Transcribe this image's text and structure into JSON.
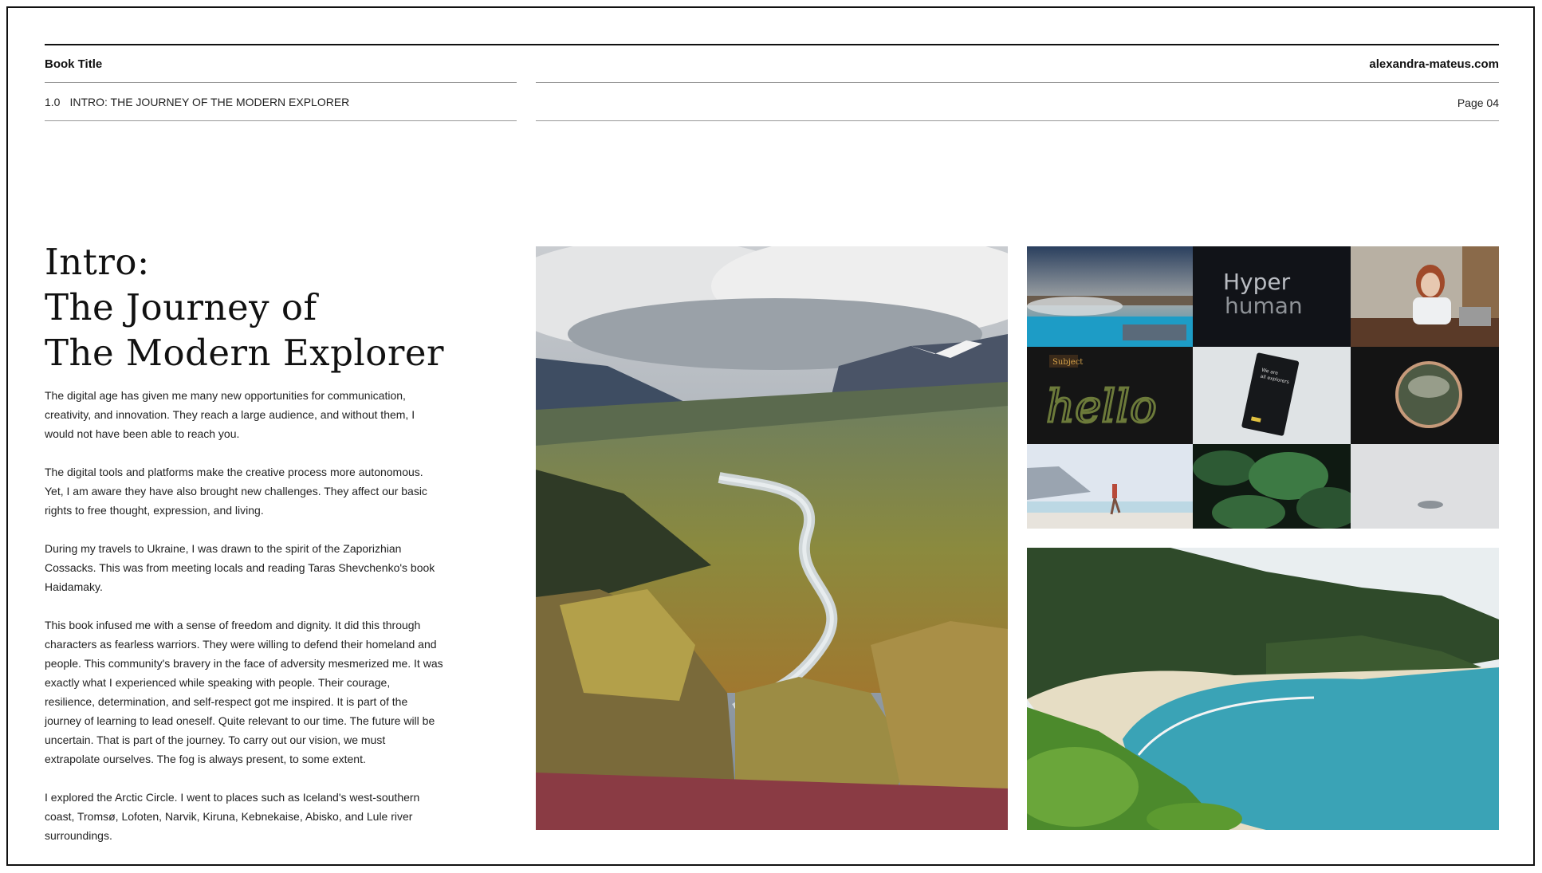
{
  "header": {
    "book_title": "Book Title",
    "site": "alexandra-mateus.com",
    "section_number": "1.0",
    "section_title": "INTRO: THE JOURNEY OF THE MODERN EXPLORER",
    "page": "Page 04"
  },
  "heading": {
    "line1": "Intro:",
    "line2": "The Journey of",
    "line3": "The Modern Explorer"
  },
  "paragraphs": [
    "The digital age has given me many new opportunities for communication, creativity, and innovation. They reach a large audience, and without them, I would not have been able to reach you.",
    "The digital tools and platforms make the creative process more autonomous. Yet, I am aware they have also brought new challenges. They affect our basic rights to free thought, expression, and living.",
    "During my travels to Ukraine, I was drawn to the spirit of the Zaporizhian Cossacks. This was from meeting locals and reading Taras Shevchenko's book Haidamaky.",
    "This book infused me with a sense of freedom and dignity. It did this through characters as fearless warriors. They were willing to defend their homeland and people. This community's bravery in the face of adversity mesmerized me. It was exactly what I experienced while speaking with people. Their courage, resilience, determination, and self-respect got me inspired. It is part of the journey of learning to lead oneself. Quite relevant to our time. The future will be uncertain. That is part of the journey. To carry out our vision, we must extrapolate ourselves. The fog is always present, to some extent.",
    "I explored the Arctic Circle. I went to places such as Iceland's west-southern coast, Tromsø, Lofoten, Narvik, Kiruna, Kebnekaise, Abisko, and Lule river surroundings."
  ],
  "thumbnails": {
    "hyper_text_1": "Hyper",
    "hyper_text_2": "human",
    "subject_tag": "Subject",
    "hello_text": "hello",
    "notebook_text_1": "We are",
    "notebook_text_2": "all explorers"
  }
}
